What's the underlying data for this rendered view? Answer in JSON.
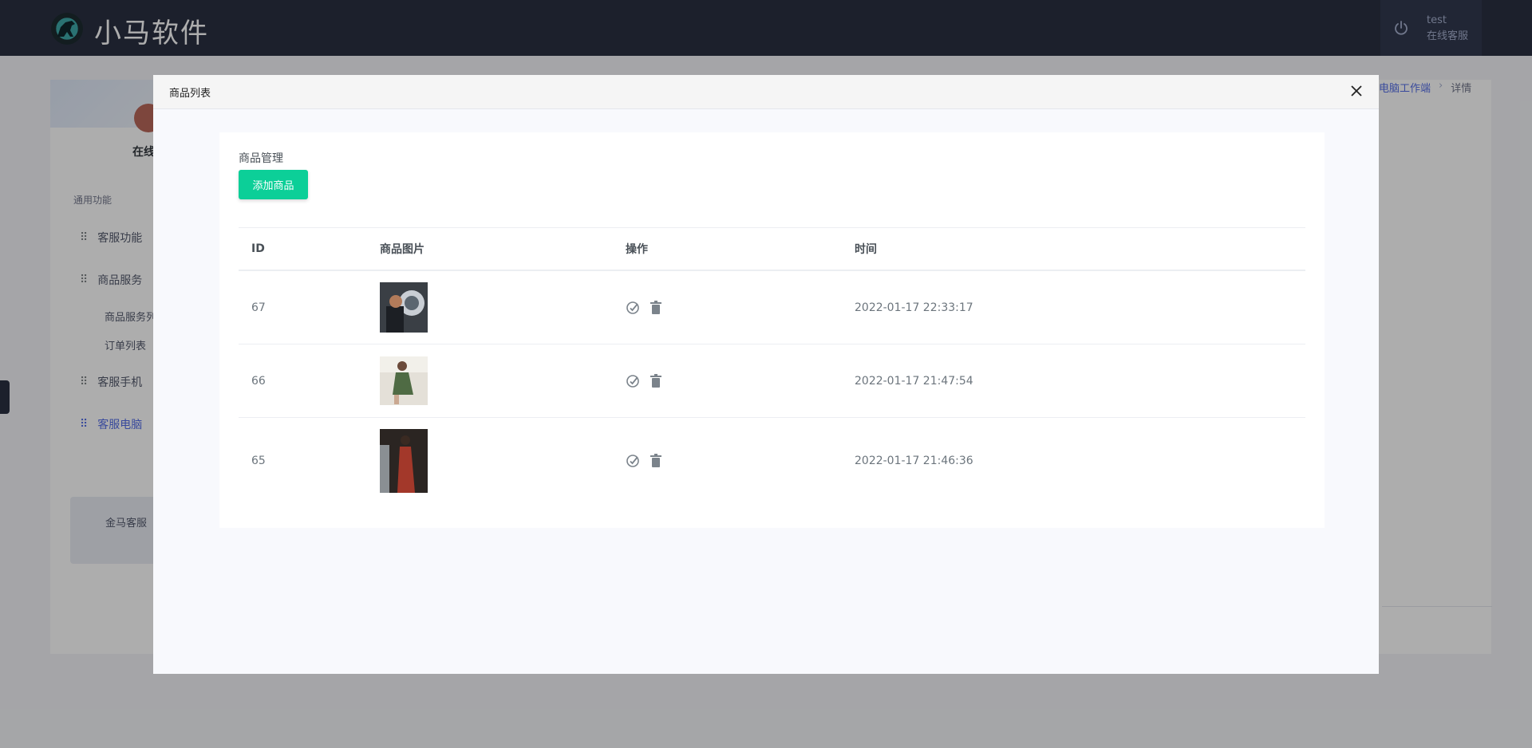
{
  "header": {
    "brand": "小马软件",
    "logo_icon": "horse-logo-icon",
    "user": {
      "name": "test",
      "role": "在线客服",
      "icon": "power-icon"
    }
  },
  "background": {
    "profile": {
      "status": "在线"
    },
    "section_title": "通用功能",
    "menu": [
      {
        "label": "客服功能",
        "icon": "grid-icon"
      },
      {
        "label": "商品服务",
        "icon": "grid-icon"
      },
      {
        "label": "客服手机",
        "icon": "grid-icon"
      },
      {
        "label": "客服电脑",
        "icon": "grid-icon",
        "active": true
      }
    ],
    "submenu": [
      {
        "label": "商品服务列"
      },
      {
        "label": "订单列表"
      }
    ],
    "notice": "金马客服",
    "breadcrumb": {
      "link": "电脑工作端",
      "separator": "›",
      "current": "详情"
    }
  },
  "modal": {
    "title": "商品列表",
    "close_icon": "close-icon",
    "card_title": "商品管理",
    "add_button": "添加商品",
    "columns": [
      "ID",
      "商品图片",
      "操作",
      "时间"
    ],
    "rows": [
      {
        "id": "67",
        "image_alt": "product-67-image",
        "time": "2022-01-17 22:33:17"
      },
      {
        "id": "66",
        "image_alt": "product-66-image",
        "time": "2022-01-17 21:47:54"
      },
      {
        "id": "65",
        "image_alt": "product-65-image",
        "time": "2022-01-17 21:46:36"
      }
    ],
    "row_actions": {
      "edit_icon": "edit-icon",
      "delete_icon": "trash-icon"
    }
  },
  "colors": {
    "header_bg": "#2a3042",
    "accent": "#556ee6",
    "success_button": "#0ccf98",
    "overlay": "rgba(0,0,0,0.32)"
  }
}
